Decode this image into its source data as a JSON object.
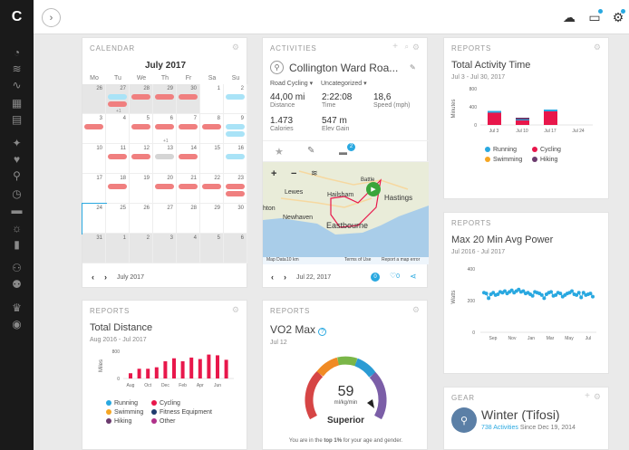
{
  "app": {
    "logo": "C"
  },
  "sidebar": {
    "icons": [
      "dashboard-icon",
      "layers-icon",
      "activity-icon",
      "calendar-icon",
      "reports-icon",
      "training-icon",
      "health-icon",
      "running-icon",
      "timer-icon",
      "shoe-icon",
      "lightbulb-icon",
      "stats-icon",
      "connections-icon",
      "groups-icon",
      "trophy-icon",
      "badge-icon"
    ]
  },
  "topbar": {
    "expand": "›"
  },
  "calendar": {
    "header": "CALENDAR",
    "month": "July 2017",
    "days": [
      "Mo",
      "Tu",
      "We",
      "Th",
      "Fr",
      "Sa",
      "Su"
    ],
    "dates": [
      [
        "26",
        "27",
        "28",
        "29",
        "30",
        "1",
        "2"
      ],
      [
        "3",
        "4",
        "5",
        "6",
        "7",
        "8",
        "9"
      ],
      [
        "10",
        "11",
        "12",
        "13",
        "14",
        "15",
        "16"
      ],
      [
        "17",
        "18",
        "19",
        "20",
        "21",
        "22",
        "23"
      ],
      [
        "24",
        "25",
        "26",
        "27",
        "28",
        "29",
        "30"
      ],
      [
        "31",
        "1",
        "2",
        "3",
        "4",
        "5",
        "6"
      ]
    ],
    "more": "+1",
    "footer": "July 2017",
    "nav_prev": "‹",
    "nav_next": "›"
  },
  "activities": {
    "header": "ACTIVITIES",
    "title": "Collington Ward Roa...",
    "type": "Road Cycling",
    "category": "Uncategorized",
    "stats": [
      {
        "v": "44,00 mi",
        "l": "Distance"
      },
      {
        "v": "2:22:08",
        "l": "Time"
      },
      {
        "v": "18,6",
        "l": "Speed (mph)"
      },
      {
        "v": "1.473",
        "l": "Calories"
      },
      {
        "v": "547 m",
        "l": "Elev Gain"
      }
    ],
    "badge": "2",
    "map_places": [
      "Lewes",
      "Hailsham",
      "Battle",
      "Hastings",
      "hton",
      "Newhaven",
      "Eastbourne"
    ],
    "map_footer": [
      "Map Data",
      "10 km",
      "Terms of Use",
      "Report a map error"
    ],
    "footer_date": "Jul 22, 2017",
    "comments": "0",
    "likes": "0"
  },
  "reports_activity": {
    "header": "REPORTS",
    "title": "Total Activity Time",
    "range": "Jul 3 - Jul 30, 2017",
    "ylabel": "Minutes",
    "yticks": [
      "800",
      "400",
      "0"
    ],
    "xticks": [
      "Jul 3",
      "Jul 10",
      "Jul 17",
      "Jul 24"
    ],
    "legend": [
      {
        "name": "Running",
        "color": "#29a8e0"
      },
      {
        "name": "Cycling",
        "color": "#e8174b"
      },
      {
        "name": "Swimming",
        "color": "#f5a623"
      },
      {
        "name": "Hiking",
        "color": "#6b3b6e"
      }
    ]
  },
  "reports_power": {
    "header": "REPORTS",
    "title": "Max 20 Min Avg Power",
    "range": "Jul 2016 - Jul 2017",
    "ylabel": "Watts",
    "yticks": [
      "400",
      "200",
      "0"
    ],
    "xticks": [
      "Sep",
      "Nov",
      "Jan",
      "Mar",
      "May",
      "Jul"
    ]
  },
  "gear": {
    "header": "GEAR",
    "title": "Winter (Tifosi)",
    "activities_link": "738 Activities",
    "since": "Since Dec 19, 2014"
  },
  "reports_distance": {
    "header": "REPORTS",
    "title": "Total Distance",
    "range": "Aug 2016 - Jul 2017",
    "ylabel": "Miles",
    "yticks": [
      "800",
      "400",
      "0"
    ],
    "xticks": [
      "Aug",
      "Oct",
      "Dec",
      "Feb",
      "Apr",
      "Jun"
    ],
    "legend": [
      {
        "name": "Running",
        "color": "#29a8e0"
      },
      {
        "name": "Cycling",
        "color": "#e8174b"
      },
      {
        "name": "Swimming",
        "color": "#f5a623"
      },
      {
        "name": "Fitness Equipment",
        "color": "#1f3a6e"
      },
      {
        "name": "Hiking",
        "color": "#6b3b6e"
      },
      {
        "name": "Other",
        "color": "#b0308a"
      }
    ]
  },
  "vo2": {
    "header": "REPORTS",
    "title": "VO2 Max",
    "date": "Jul 12",
    "value": "59",
    "unit": "ml/kg/min",
    "rating": "Superior",
    "footer_pre": "You are in the ",
    "footer_bold": "top 1%",
    "footer_post": " for your age and gender."
  },
  "chart_data": [
    {
      "type": "bar",
      "title": "Total Activity Time",
      "categories": [
        "Jul 3",
        "Jul 10",
        "Jul 17",
        "Jul 24"
      ],
      "series": [
        {
          "name": "Cycling",
          "values": [
            270,
            100,
            300,
            0
          ]
        },
        {
          "name": "Running",
          "values": [
            40,
            20,
            40,
            0
          ]
        },
        {
          "name": "Hiking",
          "values": [
            0,
            40,
            0,
            0
          ]
        }
      ],
      "ylim": [
        0,
        800
      ]
    },
    {
      "type": "scatter",
      "title": "Max 20 Min Avg Power",
      "y": [
        250,
        245,
        215,
        240,
        250,
        235,
        240,
        255,
        250,
        260,
        245,
        255,
        265,
        250,
        260,
        270,
        255,
        260,
        245,
        250,
        240,
        230,
        255,
        250,
        245,
        235,
        215,
        240,
        250,
        255,
        230,
        235,
        250,
        245,
        225,
        235,
        245,
        250,
        260,
        240,
        235,
        250,
        220,
        250,
        235,
        240,
        245,
        225
      ],
      "ylim": [
        0,
        400
      ]
    },
    {
      "type": "bar",
      "title": "Total Distance",
      "categories": [
        "Aug",
        "Sep",
        "Oct",
        "Nov",
        "Dec",
        "Jan",
        "Feb",
        "Mar",
        "Apr",
        "May",
        "Jun",
        "Jul"
      ],
      "values": [
        70,
        130,
        130,
        150,
        230,
        270,
        230,
        280,
        260,
        320,
        310,
        250
      ],
      "ylim": [
        0,
        800
      ]
    }
  ]
}
